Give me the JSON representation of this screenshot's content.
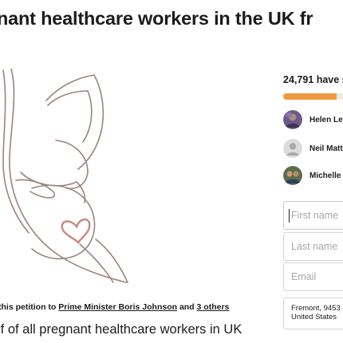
{
  "page": {
    "title": "nant healthcare workers in the UK fr"
  },
  "starter": {
    "prefix": "this petition to ",
    "recipient": "Prime Minister Boris Johnson",
    "joiner": " and ",
    "others": "3 others"
  },
  "petition": {
    "lead": "lf of all pregnant healthcare workers in UK"
  },
  "sidebar": {
    "signers_text": "24,791 have s",
    "progress_fraction": 0.84,
    "supporters": [
      {
        "name": "Helen Le",
        "avatar_icon": "supporter-photo-icon"
      },
      {
        "name": "Neil Matt",
        "avatar_icon": "default-user-icon"
      },
      {
        "name": "Michelle",
        "avatar_icon": "supporter-photo-icon"
      }
    ],
    "form": {
      "first_name_placeholder": "First name",
      "last_name_placeholder": "Last name",
      "email_placeholder": "Email"
    },
    "location": {
      "line1": "Fremont, 9453",
      "line2": "United States"
    }
  },
  "colors": {
    "progress": "#ee9a3e",
    "illustration_stroke": "#9c8480",
    "heart": "#c9867b"
  }
}
